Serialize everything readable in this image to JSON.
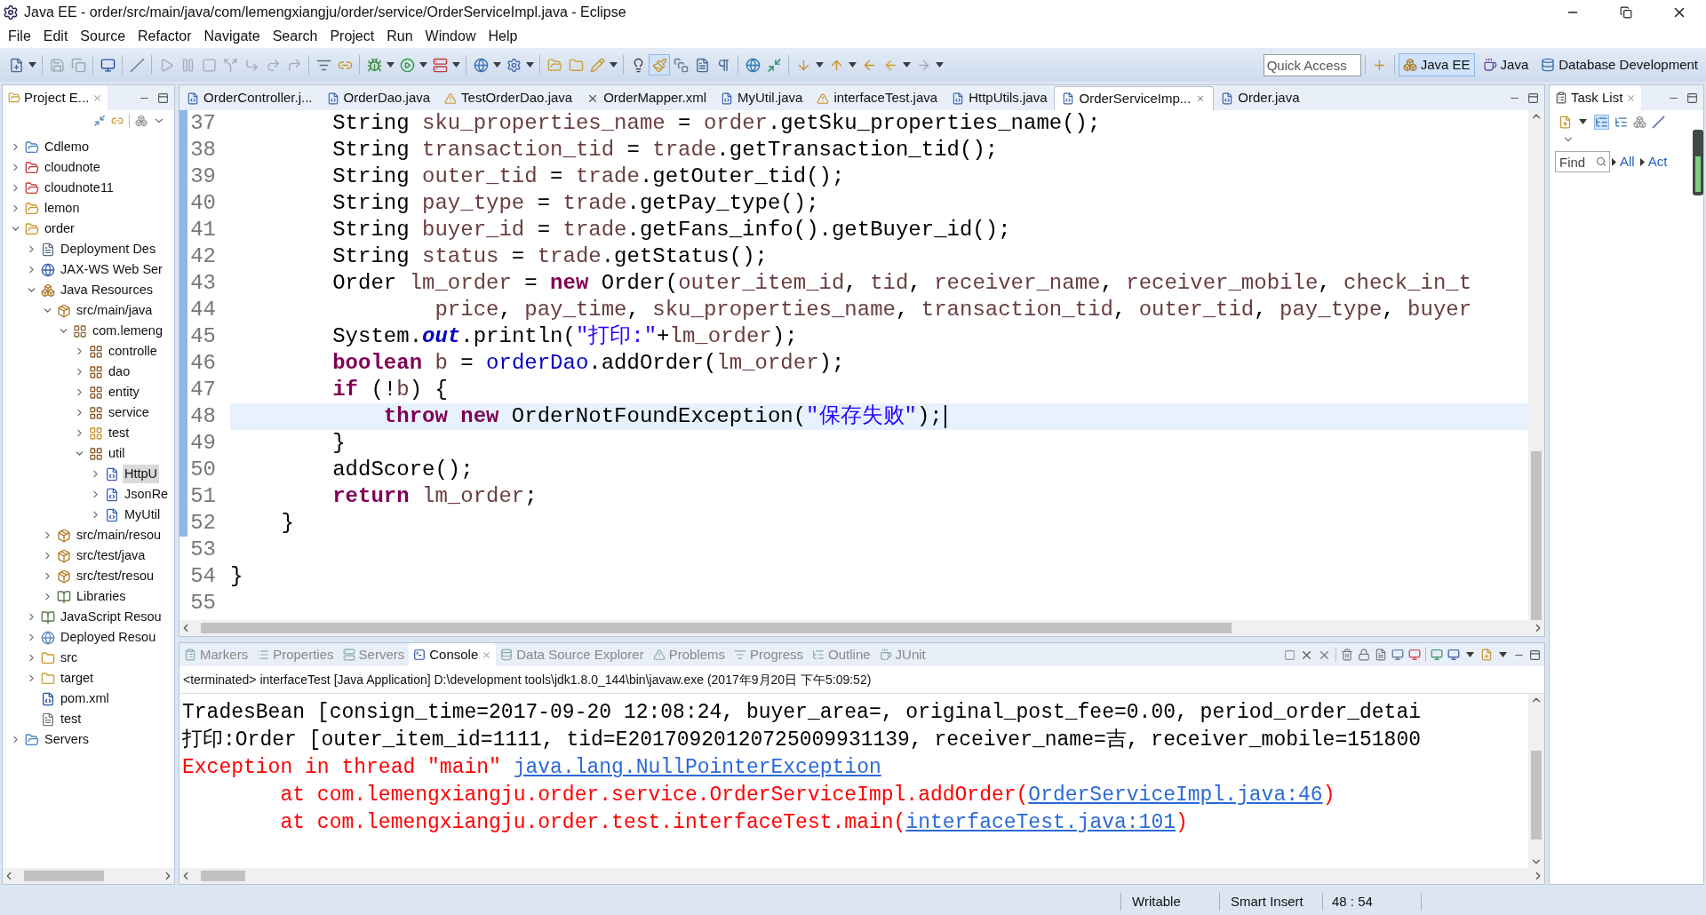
{
  "window": {
    "title": "Java EE - order/src/main/java/com/lemengxiangju/order/service/OrderServiceImpl.java - Eclipse"
  },
  "menu": [
    "File",
    "Edit",
    "Source",
    "Refactor",
    "Navigate",
    "Search",
    "Project",
    "Run",
    "Window",
    "Help"
  ],
  "toolbar": {
    "quick_access": {
      "placeholder": "Quick Access"
    },
    "perspectives": [
      {
        "label": "Java EE",
        "kind": "javaee",
        "selected": true
      },
      {
        "label": "Java",
        "kind": "java",
        "selected": false
      },
      {
        "label": "Database Development",
        "kind": "database",
        "selected": false
      }
    ]
  },
  "project_explorer": {
    "title": "Project E...",
    "tree": [
      {
        "label": "Cdlemo",
        "kind": "project",
        "expanded": false,
        "selected": false
      },
      {
        "label": "cloudnote",
        "kind": "project-error",
        "expanded": false,
        "selected": false
      },
      {
        "label": "cloudnote11",
        "kind": "project-error",
        "expanded": false,
        "selected": false
      },
      {
        "label": "lemon",
        "kind": "project-warning",
        "expanded": false,
        "selected": false
      },
      {
        "label": "order",
        "kind": "project-warning",
        "expanded": true,
        "selected": false,
        "children": [
          {
            "label": "Deployment Des",
            "kind": "descriptor",
            "expanded": false,
            "selected": false
          },
          {
            "label": "JAX-WS Web Ser",
            "kind": "webservice",
            "expanded": false,
            "selected": false
          },
          {
            "label": "Java Resources",
            "kind": "resources",
            "expanded": true,
            "selected": false,
            "children": [
              {
                "label": "src/main/java",
                "kind": "source-folder",
                "expanded": true,
                "selected": false,
                "children": [
                  {
                    "label": "com.lemeng",
                    "kind": "package-root",
                    "expanded": true,
                    "selected": false,
                    "children": [
                      {
                        "label": "controlle",
                        "kind": "package",
                        "expanded": false,
                        "selected": false
                      },
                      {
                        "label": "dao",
                        "kind": "package",
                        "expanded": false,
                        "selected": false
                      },
                      {
                        "label": "entity",
                        "kind": "package",
                        "expanded": false,
                        "selected": false
                      },
                      {
                        "label": "service",
                        "kind": "package",
                        "expanded": false,
                        "selected": false
                      },
                      {
                        "label": "test",
                        "kind": "package-warning",
                        "expanded": false,
                        "selected": false
                      },
                      {
                        "label": "util",
                        "kind": "package",
                        "expanded": true,
                        "selected": false,
                        "children": [
                          {
                            "label": "HttpU",
                            "kind": "java-file",
                            "expanded": false,
                            "selected": true
                          },
                          {
                            "label": "JsonRe",
                            "kind": "java-file",
                            "expanded": false,
                            "selected": false
                          },
                          {
                            "label": "MyUtil",
                            "kind": "java-file",
                            "expanded": false,
                            "selected": false
                          }
                        ]
                      }
                    ]
                  }
                ]
              },
              {
                "label": "src/main/resou",
                "kind": "source-folder",
                "expanded": false,
                "selected": false
              },
              {
                "label": "src/test/java",
                "kind": "source-folder",
                "expanded": false,
                "selected": false
              },
              {
                "label": "src/test/resou",
                "kind": "source-folder",
                "expanded": false,
                "selected": false
              },
              {
                "label": "Libraries",
                "kind": "library",
                "expanded": false,
                "selected": false
              }
            ]
          },
          {
            "label": "JavaScript Resou",
            "kind": "library",
            "expanded": false,
            "selected": false
          },
          {
            "label": "Deployed Resou",
            "kind": "deployed",
            "expanded": false,
            "selected": false
          },
          {
            "label": "src",
            "kind": "folder-warning",
            "expanded": false,
            "selected": false
          },
          {
            "label": "target",
            "kind": "folder",
            "expanded": false,
            "selected": false
          },
          {
            "label": "pom.xml",
            "kind": "maven-file",
            "selected": false
          },
          {
            "label": "test",
            "kind": "text-file",
            "selected": false
          }
        ]
      },
      {
        "label": "Servers",
        "kind": "folder-open",
        "expanded": false,
        "selected": false
      }
    ]
  },
  "editor": {
    "tabs": [
      {
        "label": "OrderController.j...",
        "kind": "java",
        "selected": false
      },
      {
        "label": "OrderDao.java",
        "kind": "java",
        "selected": false
      },
      {
        "label": "TestOrderDao.java",
        "kind": "java-warning",
        "selected": false
      },
      {
        "label": "OrderMapper.xml",
        "kind": "xml",
        "selected": false
      },
      {
        "label": "MyUtil.java",
        "kind": "java",
        "selected": false
      },
      {
        "label": "interfaceTest.java",
        "kind": "java-warning",
        "selected": false
      },
      {
        "label": "HttpUtils.java",
        "kind": "java",
        "selected": false
      },
      {
        "label": "OrderServiceImp...",
        "kind": "java",
        "selected": true
      },
      {
        "label": "Order.java",
        "kind": "java",
        "selected": false
      }
    ],
    "lines": [
      {
        "number": "37",
        "changed": true,
        "current": false,
        "tokens": [
          {
            "kind": "plain",
            "text": "        String "
          },
          {
            "kind": "var",
            "text": "sku_properties_name"
          },
          {
            "kind": "plain",
            "text": " = "
          },
          {
            "kind": "var",
            "text": "order"
          },
          {
            "kind": "plain",
            "text": ".getSku_properties_name();"
          }
        ]
      },
      {
        "number": "38",
        "changed": true,
        "current": false,
        "tokens": [
          {
            "kind": "plain",
            "text": "        String "
          },
          {
            "kind": "var",
            "text": "transaction_tid"
          },
          {
            "kind": "plain",
            "text": " = "
          },
          {
            "kind": "var",
            "text": "trade"
          },
          {
            "kind": "plain",
            "text": ".getTransaction_tid();"
          }
        ]
      },
      {
        "number": "39",
        "changed": true,
        "current": false,
        "tokens": [
          {
            "kind": "plain",
            "text": "        String "
          },
          {
            "kind": "var",
            "text": "outer_tid"
          },
          {
            "kind": "plain",
            "text": " = "
          },
          {
            "kind": "var",
            "text": "trade"
          },
          {
            "kind": "plain",
            "text": ".getOuter_tid();"
          }
        ]
      },
      {
        "number": "40",
        "changed": true,
        "current": false,
        "tokens": [
          {
            "kind": "plain",
            "text": "        String "
          },
          {
            "kind": "var",
            "text": "pay_type"
          },
          {
            "kind": "plain",
            "text": " = "
          },
          {
            "kind": "var",
            "text": "trade"
          },
          {
            "kind": "plain",
            "text": ".getPay_type();"
          }
        ]
      },
      {
        "number": "41",
        "changed": true,
        "current": false,
        "tokens": [
          {
            "kind": "plain",
            "text": "        String "
          },
          {
            "kind": "var",
            "text": "buyer_id"
          },
          {
            "kind": "plain",
            "text": " = "
          },
          {
            "kind": "var",
            "text": "trade"
          },
          {
            "kind": "plain",
            "text": ".getFans_info().getBuyer_id();"
          }
        ]
      },
      {
        "number": "42",
        "changed": true,
        "current": false,
        "tokens": [
          {
            "kind": "plain",
            "text": "        String "
          },
          {
            "kind": "var",
            "text": "status"
          },
          {
            "kind": "plain",
            "text": " = "
          },
          {
            "kind": "var",
            "text": "trade"
          },
          {
            "kind": "plain",
            "text": ".getStatus();"
          }
        ]
      },
      {
        "number": "43",
        "changed": true,
        "current": false,
        "tokens": [
          {
            "kind": "plain",
            "text": "        Order "
          },
          {
            "kind": "var",
            "text": "lm_order"
          },
          {
            "kind": "plain",
            "text": " = "
          },
          {
            "kind": "keyword",
            "text": "new"
          },
          {
            "kind": "plain",
            "text": " Order("
          },
          {
            "kind": "var",
            "text": "outer_item_id"
          },
          {
            "kind": "plain",
            "text": ", "
          },
          {
            "kind": "var",
            "text": "tid"
          },
          {
            "kind": "plain",
            "text": ", "
          },
          {
            "kind": "var",
            "text": "receiver_name"
          },
          {
            "kind": "plain",
            "text": ", "
          },
          {
            "kind": "var",
            "text": "receiver_mobile"
          },
          {
            "kind": "plain",
            "text": ", "
          },
          {
            "kind": "var",
            "text": "check_in_t"
          }
        ]
      },
      {
        "number": "44",
        "changed": true,
        "current": false,
        "tokens": [
          {
            "kind": "var",
            "text": "                price"
          },
          {
            "kind": "plain",
            "text": ", "
          },
          {
            "kind": "var",
            "text": "pay_time"
          },
          {
            "kind": "plain",
            "text": ", "
          },
          {
            "kind": "var",
            "text": "sku_properties_name"
          },
          {
            "kind": "plain",
            "text": ", "
          },
          {
            "kind": "var",
            "text": "transaction_tid"
          },
          {
            "kind": "plain",
            "text": ", "
          },
          {
            "kind": "var",
            "text": "outer_tid"
          },
          {
            "kind": "plain",
            "text": ", "
          },
          {
            "kind": "var",
            "text": "pay_type"
          },
          {
            "kind": "plain",
            "text": ", "
          },
          {
            "kind": "var",
            "text": "buyer"
          }
        ]
      },
      {
        "number": "45",
        "changed": true,
        "current": false,
        "tokens": [
          {
            "kind": "plain",
            "text": "        System."
          },
          {
            "kind": "static",
            "text": "out"
          },
          {
            "kind": "plain",
            "text": ".println("
          },
          {
            "kind": "string",
            "text": "\"打印:\""
          },
          {
            "kind": "plain",
            "text": "+"
          },
          {
            "kind": "var",
            "text": "lm_order"
          },
          {
            "kind": "plain",
            "text": ");"
          }
        ]
      },
      {
        "number": "46",
        "changed": true,
        "current": false,
        "tokens": [
          {
            "kind": "keyword",
            "text": "        boolean"
          },
          {
            "kind": "var",
            "text": " b"
          },
          {
            "kind": "plain",
            "text": " = "
          },
          {
            "kind": "field",
            "text": "orderDao"
          },
          {
            "kind": "plain",
            "text": ".addOrder("
          },
          {
            "kind": "var",
            "text": "lm_order"
          },
          {
            "kind": "plain",
            "text": ");"
          }
        ]
      },
      {
        "number": "47",
        "changed": true,
        "current": false,
        "tokens": [
          {
            "kind": "keyword",
            "text": "        if"
          },
          {
            "kind": "plain",
            "text": " (!"
          },
          {
            "kind": "var",
            "text": "b"
          },
          {
            "kind": "plain",
            "text": ") {"
          }
        ]
      },
      {
        "number": "48",
        "changed": true,
        "current": true,
        "tokens": [
          {
            "kind": "keyword",
            "text": "            throw"
          },
          {
            "kind": "keyword",
            "text": " new"
          },
          {
            "kind": "plain",
            "text": " OrderNotFoundException("
          },
          {
            "kind": "string",
            "text": "\"保存失败\""
          },
          {
            "kind": "plain",
            "text": ");"
          }
        ]
      },
      {
        "number": "49",
        "changed": true,
        "current": false,
        "tokens": [
          {
            "kind": "plain",
            "text": "        }"
          }
        ]
      },
      {
        "number": "50",
        "changed": true,
        "current": false,
        "tokens": [
          {
            "kind": "plain",
            "text": "        addScore();"
          }
        ]
      },
      {
        "number": "51",
        "changed": true,
        "current": false,
        "tokens": [
          {
            "kind": "keyword",
            "text": "        return"
          },
          {
            "kind": "var",
            "text": " lm_order"
          },
          {
            "kind": "plain",
            "text": ";"
          }
        ]
      },
      {
        "number": "52",
        "changed": true,
        "current": false,
        "tokens": [
          {
            "kind": "plain",
            "text": "    }"
          }
        ]
      },
      {
        "number": "53",
        "changed": false,
        "current": false
      },
      {
        "number": "54",
        "changed": false,
        "current": false,
        "tokens": [
          {
            "kind": "plain",
            "text": "}"
          }
        ]
      },
      {
        "number": "55",
        "changed": false,
        "current": false
      }
    ]
  },
  "console": {
    "tabs": [
      {
        "label": "Markers",
        "kind": "markers",
        "selected": false
      },
      {
        "label": "Properties",
        "kind": "properties",
        "selected": false
      },
      {
        "label": "Servers",
        "kind": "servers",
        "selected": false
      },
      {
        "label": "Console",
        "kind": "console",
        "selected": true
      },
      {
        "label": "Data Source Explorer",
        "kind": "datasource",
        "selected": false
      },
      {
        "label": "Problems",
        "kind": "problems",
        "selected": false
      },
      {
        "label": "Progress",
        "kind": "progress",
        "selected": false
      },
      {
        "label": "Outline",
        "kind": "outline",
        "selected": false
      },
      {
        "label": "JUnit",
        "kind": "junit",
        "selected": false
      }
    ],
    "status": "<terminated> interfaceTest [Java Application] D:\\development tools\\jdk1.8.0_144\\bin\\javaw.exe (2017年9月20日 下午5:09:52)",
    "lines": [
      [
        {
          "kind": "out",
          "text": "TradesBean [consign_time=2017-09-20 12:08:24, buyer_area=, original_post_fee=0.00, period_order_detai"
        }
      ],
      [
        {
          "kind": "out",
          "text": "打印:Order [outer_item_id=1111, tid=E20170920120725009931139, receiver_name=吉, receiver_mobile=151800"
        }
      ],
      [
        {
          "kind": "err",
          "text": "Exception in thread \"main\" "
        },
        {
          "kind": "link",
          "text": "java.lang.NullPointerException"
        }
      ],
      [
        {
          "kind": "err",
          "text": "\tat com.lemengxiangju.order.service.OrderServiceImpl.addOrder("
        },
        {
          "kind": "link",
          "text": "OrderServiceImpl.java:46"
        },
        {
          "kind": "err",
          "text": ")"
        }
      ],
      [
        {
          "kind": "err",
          "text": "\tat com.lemengxiangju.order.test.interfaceTest.main("
        },
        {
          "kind": "link",
          "text": "interfaceTest.java:101"
        },
        {
          "kind": "err",
          "text": ")"
        }
      ]
    ]
  },
  "task_list": {
    "title": "Task List",
    "find": {
      "placeholder": "Find"
    },
    "filters": [
      "All",
      "Act"
    ]
  },
  "status_bar": {
    "mode": "Writable",
    "insert_mode": "Smart Insert",
    "position": "48 : 54"
  }
}
